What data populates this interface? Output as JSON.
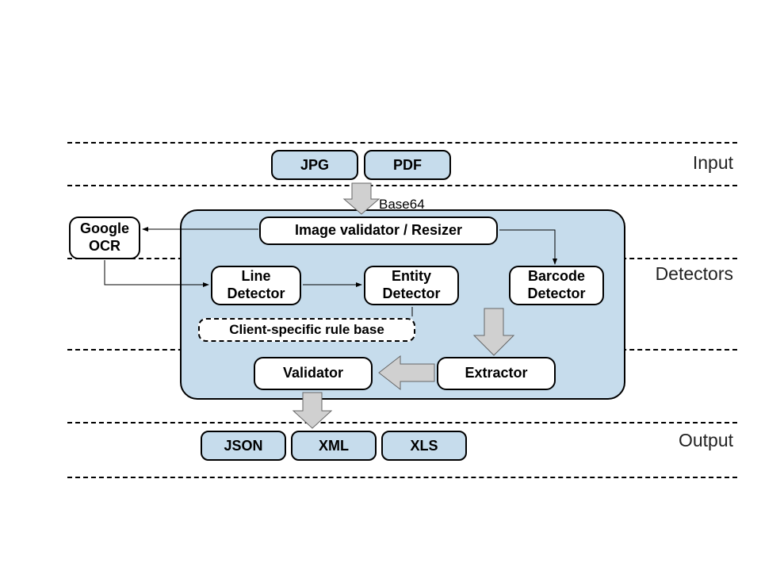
{
  "sections": {
    "input": "Input",
    "detectors": "Detectors",
    "output": "Output"
  },
  "inputs": {
    "jpg": "JPG",
    "pdf": "PDF"
  },
  "annotations": {
    "base64": "Base64"
  },
  "external": {
    "google_ocr": "Google OCR"
  },
  "pipeline": {
    "image_validator": "Image validator / Resizer",
    "line_detector": "Line Detector",
    "entity_detector": "Entity Detector",
    "barcode_detector": "Barcode Detector",
    "rule_base": "Client-specific rule base",
    "validator": "Validator",
    "extractor": "Extractor"
  },
  "outputs": {
    "json": "JSON",
    "xml": "XML",
    "xls": "XLS"
  }
}
